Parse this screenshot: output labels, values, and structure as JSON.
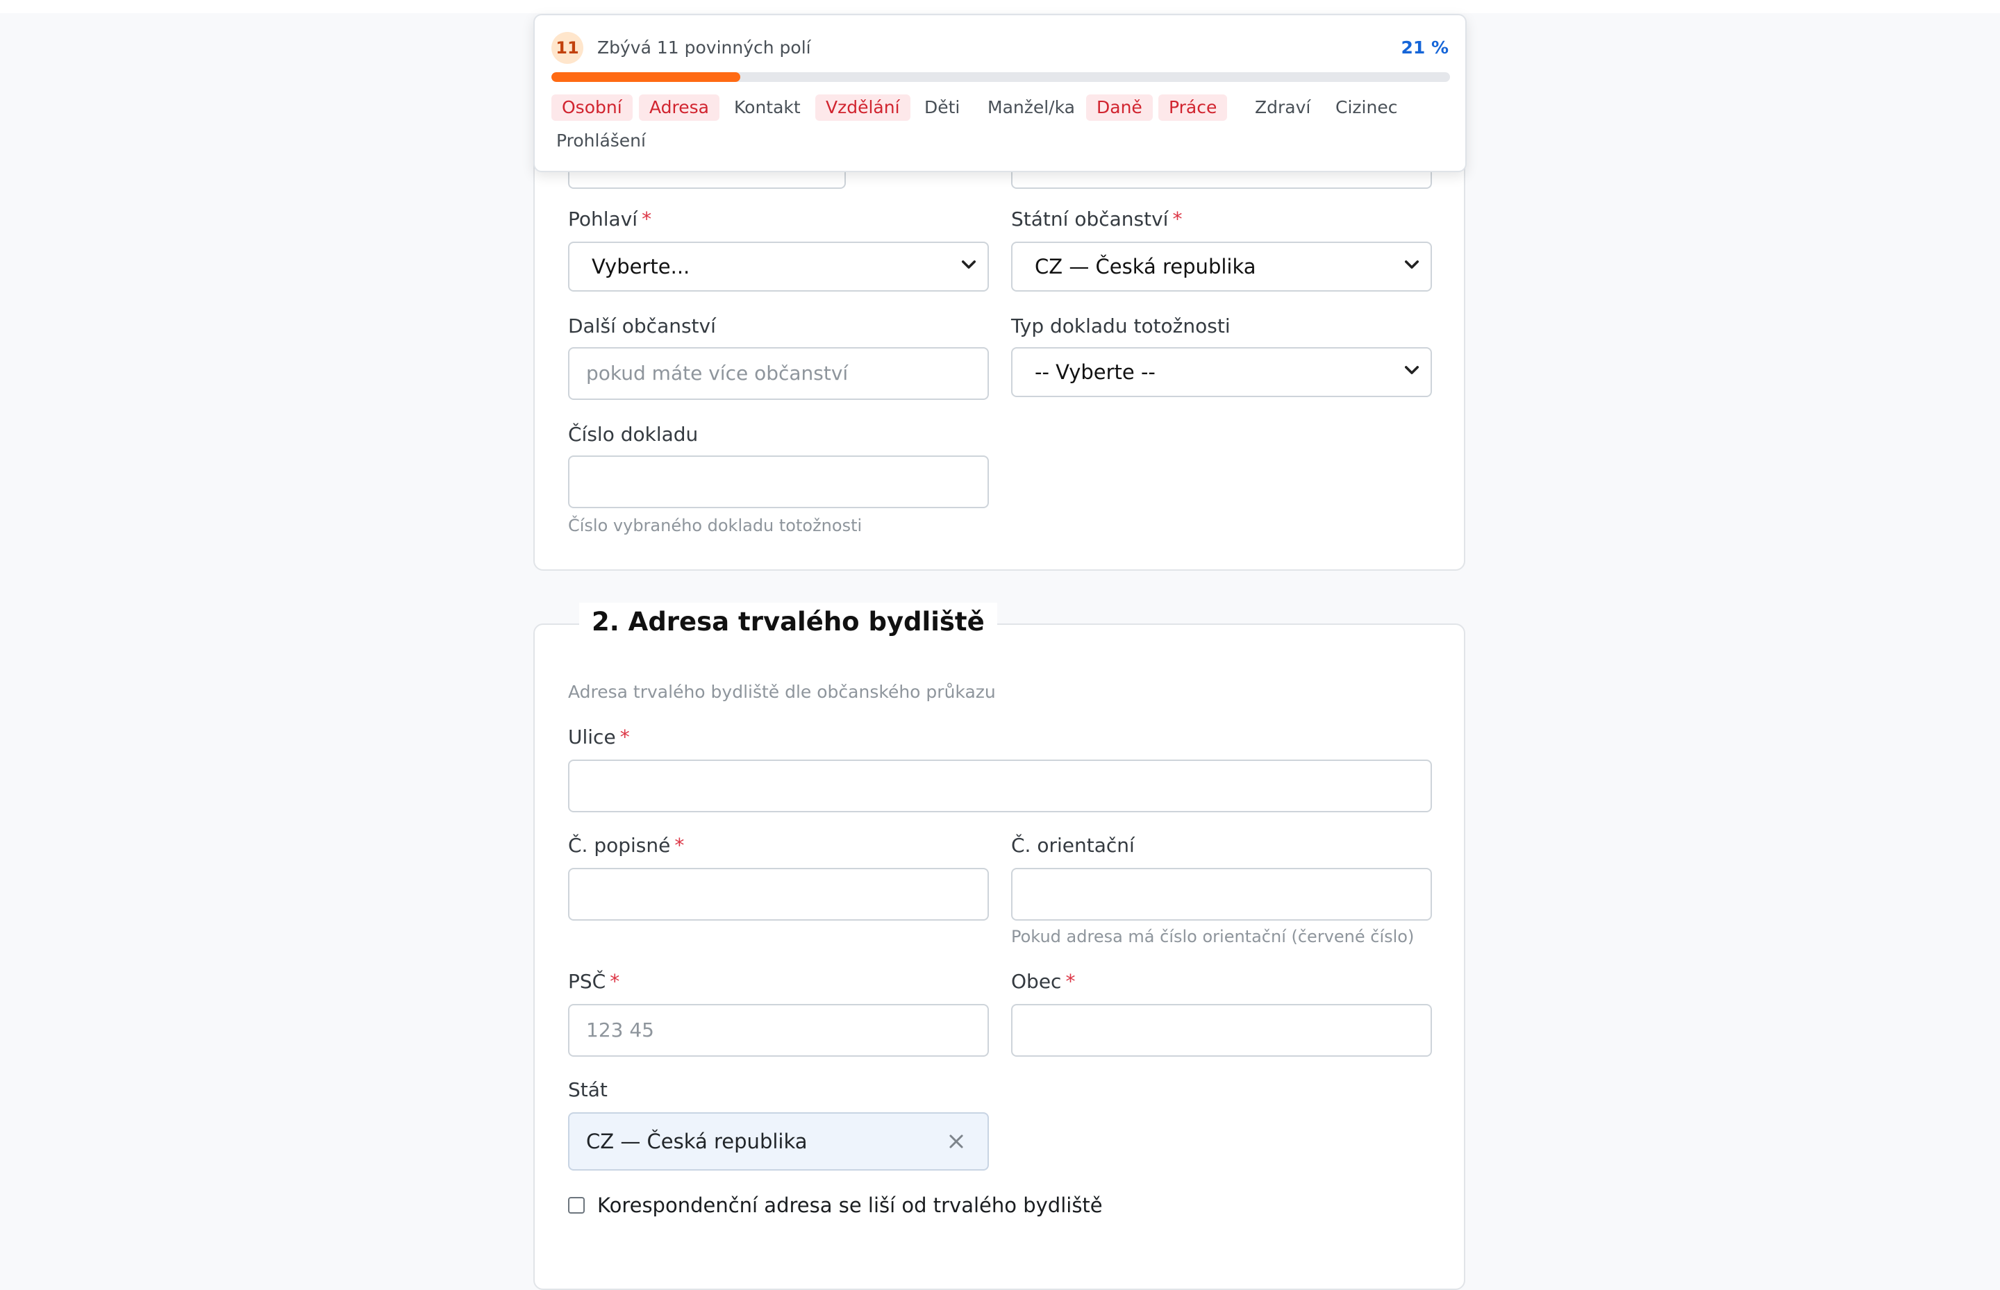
{
  "progress": {
    "remaining_count": "11",
    "remaining_text": "Zbývá 11 povinných polí",
    "percent_text": "21 %",
    "percent_value": 21,
    "fill_color": "#ff6a13",
    "sections": [
      {
        "label": "Osobní",
        "incomplete": true
      },
      {
        "label": "Adresa",
        "incomplete": true
      },
      {
        "label": "Kontakt",
        "incomplete": false
      },
      {
        "label": "Vzdělání",
        "incomplete": true
      },
      {
        "label": "Děti",
        "incomplete": false
      },
      {
        "label": "Manžel/ka",
        "incomplete": false
      },
      {
        "label": "Daně",
        "incomplete": true
      },
      {
        "label": "Práce",
        "incomplete": true
      },
      {
        "label": "Zdraví",
        "incomplete": false
      },
      {
        "label": "Cizinec",
        "incomplete": false
      },
      {
        "label": "Prohlášení",
        "incomplete": false
      }
    ]
  },
  "personal": {
    "gender": {
      "label": "Pohlaví",
      "value": "Vyberte...",
      "required": "*"
    },
    "citizenship": {
      "label": "Státní občanství",
      "value": "CZ — Česká republika",
      "required": "*"
    },
    "other_citizenship": {
      "label": "Další občanství",
      "placeholder": "pokud máte více občanství"
    },
    "id_type": {
      "label": "Typ dokladu totožnosti",
      "value": "-- Vyberte --"
    },
    "id_number": {
      "label": "Číslo dokladu",
      "value": "",
      "help": "Číslo vybraného dokladu totožnosti"
    }
  },
  "address": {
    "title": "2. Adresa trvalého bydliště",
    "description": "Adresa trvalého bydliště dle občanského průkazu",
    "street": {
      "label": "Ulice",
      "required": "*",
      "value": ""
    },
    "house_number": {
      "label": "Č. popisné",
      "required": "*",
      "value": ""
    },
    "orientation_number": {
      "label": "Č. orientační",
      "value": "",
      "help": "Pokud adresa má číslo orientační (červené číslo)"
    },
    "zip": {
      "label": "PSČ",
      "required": "*",
      "placeholder": "123 45"
    },
    "city": {
      "label": "Obec",
      "required": "*",
      "value": ""
    },
    "country": {
      "label": "Stát",
      "value": "CZ — Česká republika"
    },
    "correspondence_checkbox": {
      "label": "Korespondenční adresa se liší od trvalého bydliště",
      "checked": false
    }
  }
}
